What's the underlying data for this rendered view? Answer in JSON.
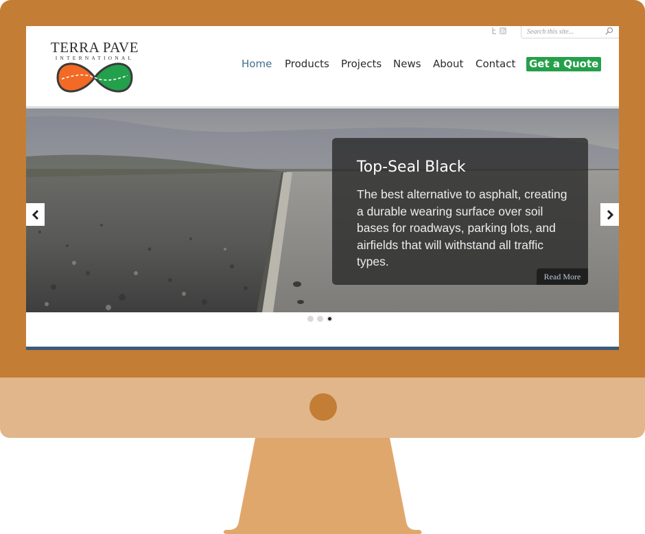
{
  "brand": {
    "name": "TERRA PAVE",
    "tagline": "INTERNATIONAL",
    "colors": {
      "orange": "#f26a25",
      "green": "#23a04b",
      "dark": "#2d2d2d"
    }
  },
  "header": {
    "social_icons": [
      "twitter-icon",
      "rss-icon"
    ],
    "search": {
      "placeholder": "Search this site..."
    }
  },
  "nav": {
    "items": [
      {
        "label": "Home",
        "active": true
      },
      {
        "label": "Products",
        "active": false
      },
      {
        "label": "Projects",
        "active": false
      },
      {
        "label": "News",
        "active": false
      },
      {
        "label": "About",
        "active": false
      },
      {
        "label": "Contact",
        "active": false
      }
    ],
    "cta_label": "Get a Quote",
    "cta_color": "#25a04a",
    "active_color": "#3f6f8f"
  },
  "slider": {
    "caption_title": "Top-Seal Black",
    "caption_text": "The best alternative to asphalt, creating a durable wearing surface over soil bases for roadways, parking lots, and airfields that will withstand all traffic types.",
    "read_more_label": "Read More",
    "dots": [
      false,
      false,
      true
    ]
  },
  "monitor": {
    "frame_color": "#c47d34",
    "chin_color": "#e1b68b",
    "stand_color": "#e0a76d"
  }
}
